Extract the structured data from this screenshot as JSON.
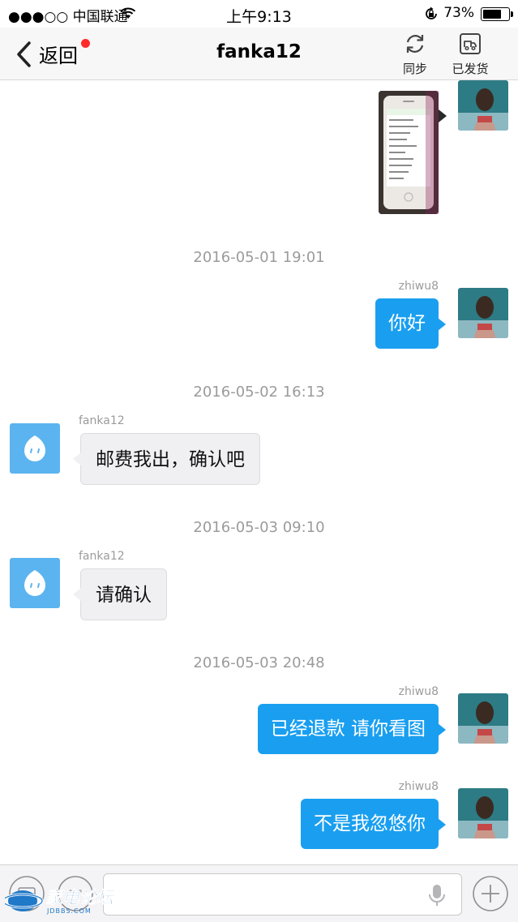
{
  "status_bar": {
    "carrier": "●●●○○ 中国联通",
    "time": "上午9:13",
    "battery_percent": "73%",
    "battery_level": 0.73
  },
  "nav": {
    "back_label": "返回",
    "title": "fanka12",
    "sync_label": "同步",
    "shipped_label": "已发货"
  },
  "messages": [
    {
      "type": "image",
      "sender": "zhiwu8",
      "direction": "out"
    },
    {
      "type": "timestamp",
      "text": "2016-05-01 19:01"
    },
    {
      "type": "text",
      "sender": "zhiwu8",
      "direction": "out",
      "text": "你好"
    },
    {
      "type": "timestamp",
      "text": "2016-05-02 16:13"
    },
    {
      "type": "text",
      "sender": "fanka12",
      "direction": "in",
      "text": "邮费我出，确认吧"
    },
    {
      "type": "timestamp",
      "text": "2016-05-03 09:10"
    },
    {
      "type": "text",
      "sender": "fanka12",
      "direction": "in",
      "text": "请确认"
    },
    {
      "type": "timestamp",
      "text": "2016-05-03 20:48"
    },
    {
      "type": "text",
      "sender": "zhiwu8",
      "direction": "out",
      "text": "已经退款 请你看图"
    },
    {
      "type": "text",
      "sender": "zhiwu8",
      "direction": "out",
      "text": "不是我忽悠你"
    }
  ],
  "watermark": {
    "text": "家电论坛",
    "sub": "JDBBS.COM"
  },
  "input": {
    "placeholder": ""
  },
  "colors": {
    "bubble_out": "#1a9ff0",
    "bubble_in": "#f0f0f3",
    "badge": "#ff2a2a",
    "bot_avatar": "#5bb4ef"
  }
}
